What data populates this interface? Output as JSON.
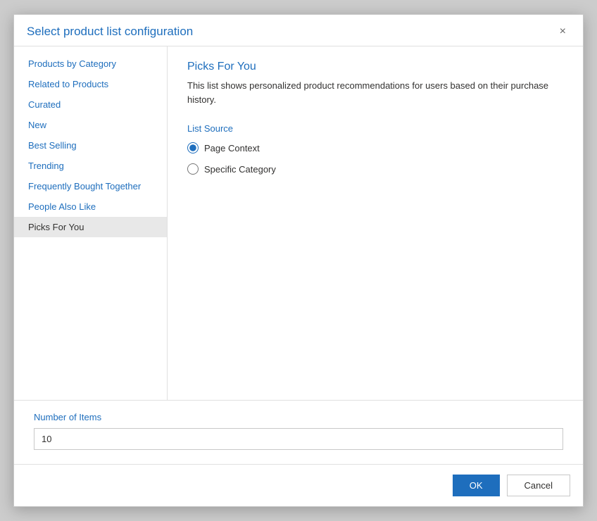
{
  "dialog": {
    "title": "Select product list configuration",
    "close_label": "×"
  },
  "sidebar": {
    "items": [
      {
        "id": "products-by-category",
        "label": "Products by Category",
        "active": false
      },
      {
        "id": "related-to-products",
        "label": "Related to Products",
        "active": false
      },
      {
        "id": "curated",
        "label": "Curated",
        "active": false
      },
      {
        "id": "new",
        "label": "New",
        "active": false
      },
      {
        "id": "best-selling",
        "label": "Best Selling",
        "active": false
      },
      {
        "id": "trending",
        "label": "Trending",
        "active": false
      },
      {
        "id": "frequently-bought-together",
        "label": "Frequently Bought Together",
        "active": false
      },
      {
        "id": "people-also-like",
        "label": "People Also Like",
        "active": false
      },
      {
        "id": "picks-for-you",
        "label": "Picks For You",
        "active": true
      }
    ]
  },
  "main": {
    "title": "Picks For You",
    "description": "This list shows personalized product recommendations for users based on their purchase history.",
    "list_source_label": "List Source",
    "radio_options": [
      {
        "id": "page-context",
        "label": "Page Context",
        "checked": true
      },
      {
        "id": "specific-category",
        "label": "Specific Category",
        "checked": false
      }
    ]
  },
  "footer": {
    "number_of_items_label": "Number of Items",
    "number_input_value": "10",
    "ok_label": "OK",
    "cancel_label": "Cancel"
  }
}
